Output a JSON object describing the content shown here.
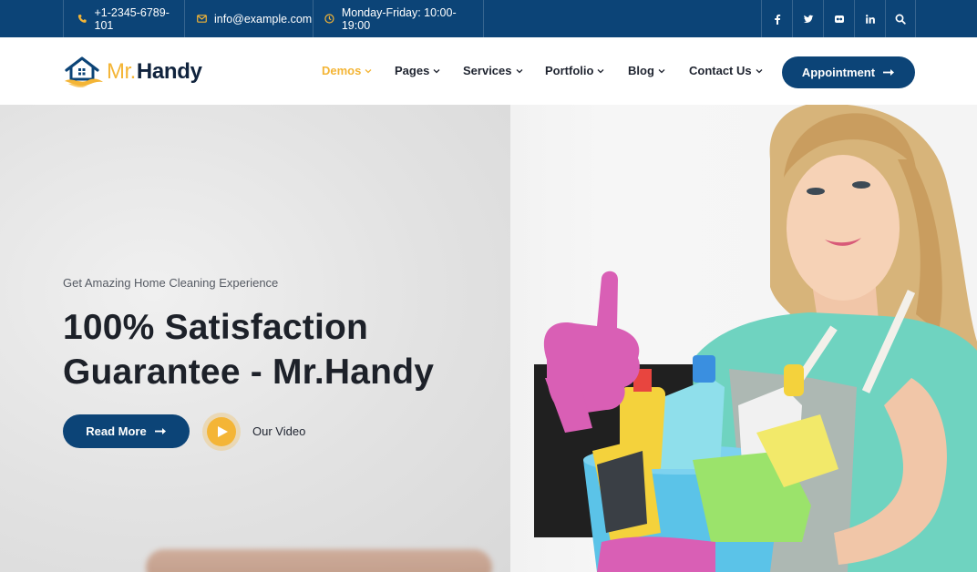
{
  "colors": {
    "brand_blue": "#0c4477",
    "accent_yellow": "#f4b536",
    "dark_text": "#1d2129"
  },
  "topbar": {
    "phone": "+1-2345-6789-101",
    "email": "info@example.com",
    "hours": "Monday-Friday: 10:00-19:00",
    "phone_icon": "phone-icon",
    "email_icon": "envelope-icon",
    "hours_icon": "clock-icon",
    "social": [
      "facebook-icon",
      "twitter-icon",
      "flickr-icon",
      "linkedin-icon",
      "search-icon"
    ]
  },
  "logo": {
    "part1": "Mr.",
    "part2": "Handy"
  },
  "nav": {
    "items": [
      {
        "label": "Demos",
        "active": true
      },
      {
        "label": "Pages"
      },
      {
        "label": "Services"
      },
      {
        "label": "Portfolio"
      },
      {
        "label": "Blog"
      },
      {
        "label": "Contact Us"
      }
    ],
    "cta": "Appointment"
  },
  "hero": {
    "eyebrow": "Get Amazing Home Cleaning Experience",
    "headline_line1": "100% Satisfaction",
    "headline_line2": "Guarantee - Mr.Handy",
    "primary_button": "Read More",
    "video_label": "Our Video"
  }
}
